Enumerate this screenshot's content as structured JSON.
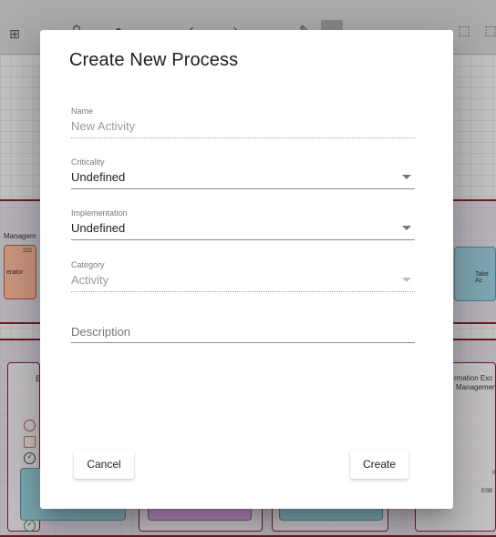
{
  "dialog": {
    "title": "Create New Process",
    "fields": {
      "name": {
        "label": "Name",
        "placeholder": "New Activity"
      },
      "criticality": {
        "label": "Criticality",
        "value": "Undefined"
      },
      "implementation": {
        "label": "Implementation",
        "value": "Undefined"
      },
      "category": {
        "label": "Category",
        "value": "Activity"
      },
      "description": {
        "placeholder": "Description"
      }
    },
    "buttons": {
      "cancel": "Cancel",
      "create": "Create"
    }
  },
  "background": {
    "lane1_label": "Managem",
    "lane1_box_text": "erator",
    "lane1_badge": "222",
    "lane1_right": "Take Ac",
    "lane2_letter": "B",
    "lane2_right_1": "rmation Exc",
    "lane2_right_2": "Managemen",
    "lane2_esb": "ESB",
    "lane2_zero": "0"
  }
}
